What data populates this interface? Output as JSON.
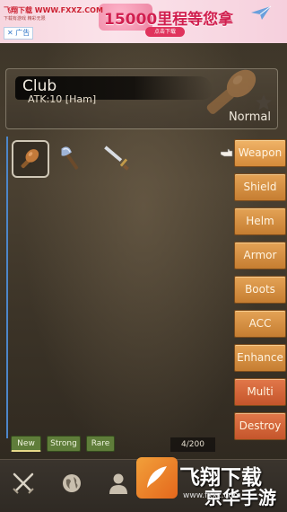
{
  "ad": {
    "site_name": "飞翔下载 WWW.FXXZ.COM",
    "site_sub": "下载有游戏 精彩无限",
    "headline": "15000里程等您拿",
    "cta": "点击下载",
    "close": "广告"
  },
  "item": {
    "name": "Club",
    "stat": "ATK:10 [Ham]",
    "rarity": "Normal"
  },
  "weapons": [
    {
      "icon": "club-icon",
      "selected": true
    },
    {
      "icon": "axe-icon",
      "selected": false
    },
    {
      "icon": "sword-icon",
      "selected": false
    }
  ],
  "categories": [
    {
      "label": "Weapon",
      "active": true
    },
    {
      "label": "Shield"
    },
    {
      "label": "Helm"
    },
    {
      "label": "Armor"
    },
    {
      "label": "Boots"
    },
    {
      "label": "ACC"
    },
    {
      "label": "Enhance"
    },
    {
      "label": "Multi"
    },
    {
      "label": "Destroy"
    }
  ],
  "sort": {
    "new": "New",
    "strong": "Strong",
    "rare": "Rare"
  },
  "inventory_count": "4/200",
  "nav": [
    "battle-icon",
    "world-icon",
    "hero-icon"
  ],
  "watermark": {
    "line1": "飞翔下载",
    "line2": "京华手游",
    "line3": "www.fxxz.com"
  },
  "colors": {
    "category_button": "#d48a3a",
    "category_red": "#c5552b",
    "sort_chip": "#5f7d3a",
    "rail": "#4d86c9"
  }
}
